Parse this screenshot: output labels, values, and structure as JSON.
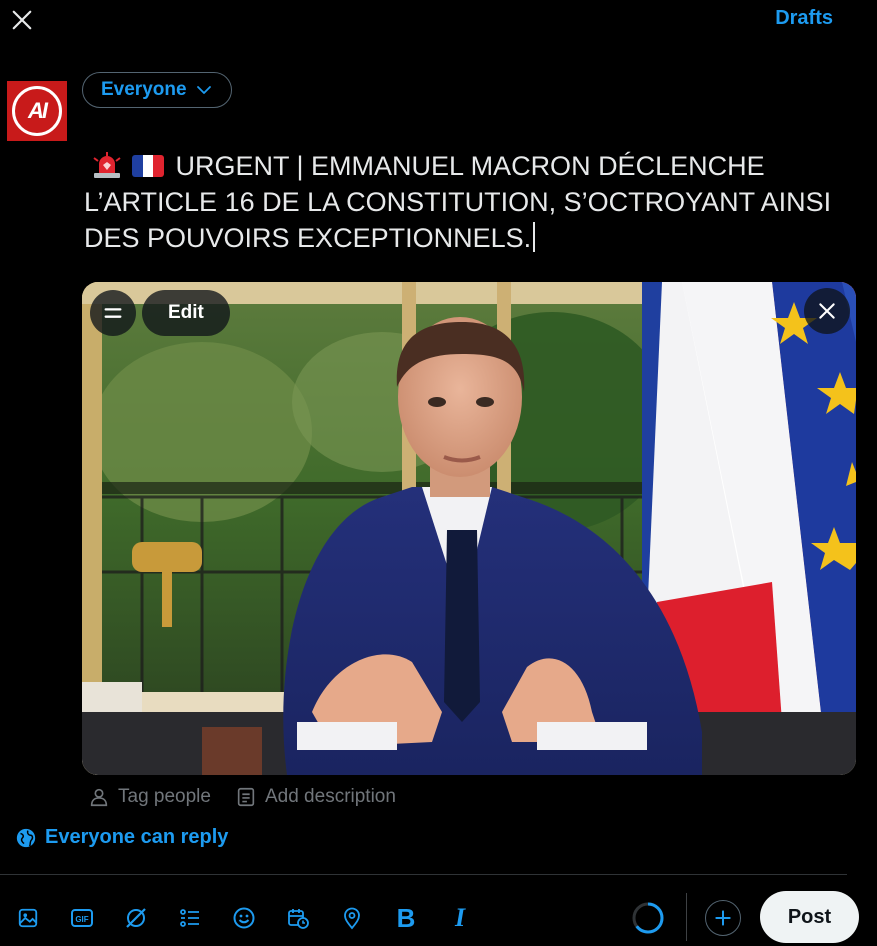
{
  "header": {
    "close_icon": "close-icon",
    "drafts_label": "Drafts"
  },
  "account": {
    "avatar_text": "AI",
    "brand_color": "#c81a1a"
  },
  "audience": {
    "label": "Everyone",
    "icon": "chevron-down-icon"
  },
  "compose": {
    "emoji_prefix": [
      "police-car-light",
      "flag-france"
    ],
    "text": "URGENT | EMMANUEL MACRON DÉCLENCHE L’ARTICLE 16 DE LA CONSTITUTION, S’OCTROYANT AINSI DES POUVOIRS EXCEPTIONNELS."
  },
  "media": {
    "edit_label": "Edit",
    "menu_icon": "equals-icon",
    "remove_icon": "close-icon",
    "tag_people_label": "Tag people",
    "add_description_label": "Add description"
  },
  "reply_setting": {
    "label": "Everyone can reply",
    "icon": "globe-icon"
  },
  "toolbar": {
    "icons": [
      "image-icon",
      "gif-icon",
      "grok-icon",
      "poll-icon",
      "emoji-icon",
      "schedule-icon",
      "location-icon",
      "bold-icon",
      "italic-icon"
    ],
    "bold_label": "B",
    "italic_label": "I",
    "post_label": "Post"
  },
  "colors": {
    "accent": "#1d9bf0",
    "background": "#000000",
    "text": "#e7e9ea",
    "muted": "#71767b"
  }
}
